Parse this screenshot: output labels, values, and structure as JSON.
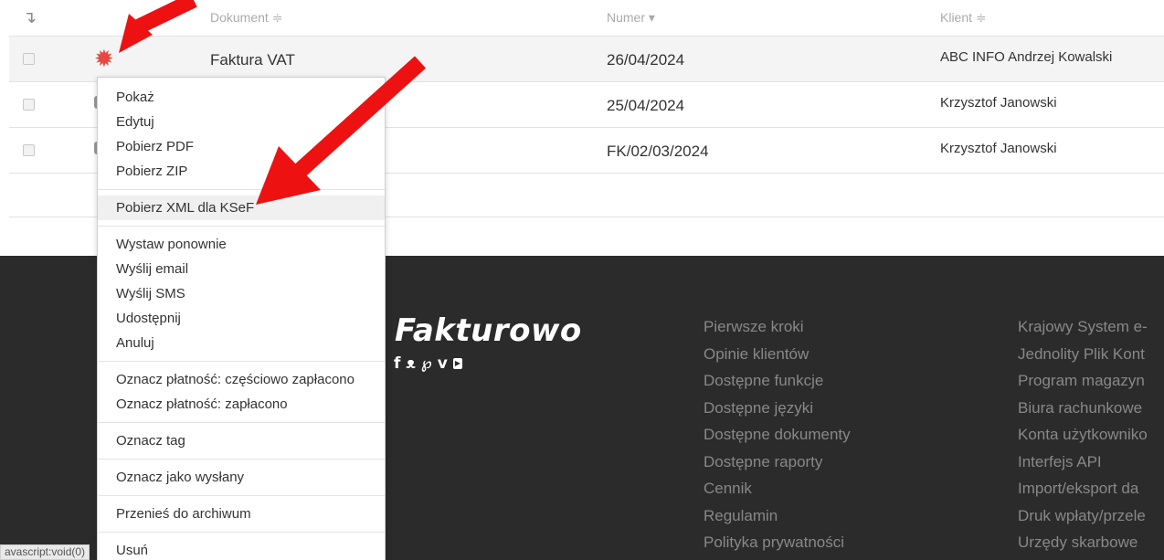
{
  "table": {
    "headers": {
      "document": "Dokument ≑",
      "number": "Numer ▾",
      "client": "Klient ≑"
    },
    "rows": [
      {
        "document": "Faktura VAT",
        "number": "26/04/2024",
        "client": "ABC INFO Andrzej Kowalski"
      },
      {
        "document": "",
        "number": "25/04/2024",
        "client": "Krzysztof Janowski"
      },
      {
        "document": "",
        "number": "FK/02/03/2024",
        "client": "Krzysztof Janowski"
      }
    ]
  },
  "menu": {
    "show": "Pokaż",
    "edit": "Edytuj",
    "download_pdf": "Pobierz PDF",
    "download_zip": "Pobierz ZIP",
    "download_xml": "Pobierz XML dla KSeF",
    "reissue": "Wystaw ponownie",
    "send_email": "Wyślij email",
    "send_sms": "Wyślij SMS",
    "share": "Udostępnij",
    "cancel": "Anuluj",
    "mark_partial": "Oznacz płatność: częściowo zapłacono",
    "mark_paid": "Oznacz płatność: zapłacono",
    "mark_tag": "Oznacz tag",
    "mark_sent": "Oznacz jako wysłany",
    "archive": "Przenieś do archiwum",
    "delete": "Usuń"
  },
  "footer": {
    "brand": "Fakturowo",
    "col1": [
      "Pierwsze kroki",
      "Opinie klientów",
      "Dostępne funkcje",
      "Dostępne języki",
      "Dostępne dokumenty",
      "Dostępne raporty",
      "Cennik",
      "Regulamin",
      "Polityka prywatności"
    ],
    "col2": [
      "Krajowy System e-",
      "Jednolity Plik Kont",
      "Program magazyn",
      "Biura rachunkowe",
      "Konta użytkowniko",
      "Interfejs API",
      "Import/eksport da",
      "Druk wpłaty/przele",
      "Urzędy skarbowe"
    ]
  },
  "status_bar": {
    "text": "avascript:void(0)"
  },
  "icons": {
    "sort": "sort-down-icon",
    "gear": "gear-icon",
    "social": [
      "facebook-icon",
      "twitter-icon",
      "pinterest-icon",
      "vimeo-icon",
      "youtube-icon"
    ]
  },
  "colors": {
    "gear": "#e8473f",
    "arrow": "#ee1111",
    "footer_bg": "#2b2b2b",
    "footer_link": "#888888"
  }
}
